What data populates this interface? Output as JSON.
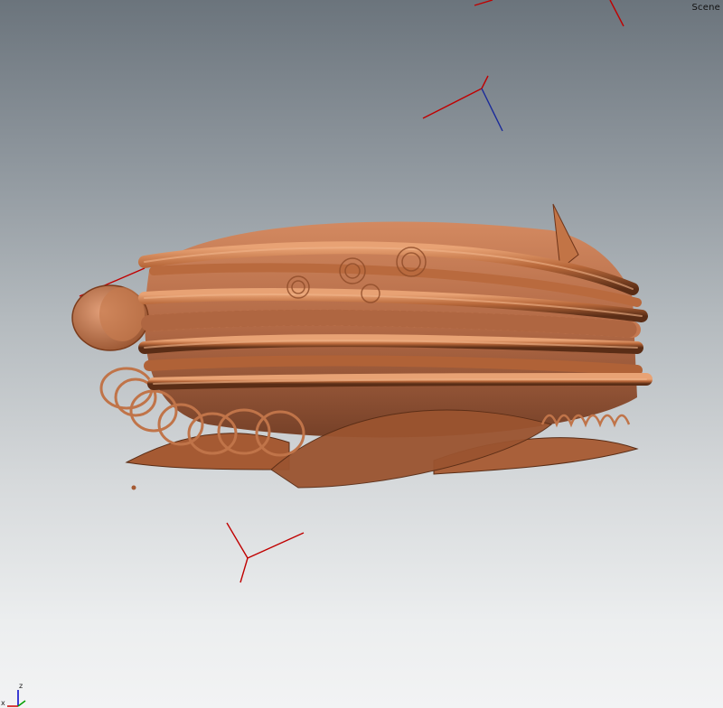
{
  "viewport": {
    "scene_label": "Scene",
    "background_top": "#6b747c",
    "background_bottom": "#f2f3f4"
  },
  "object": {
    "icon": "volume-render-copper-coils",
    "color": "#b8683a",
    "highlight": "#e49a6a",
    "shadow": "#5a2d16"
  },
  "axis_triad": {
    "x_label": "x",
    "z_label": "z",
    "x_color": "#d00000",
    "y_color": "#00a000",
    "z_color": "#0000c8"
  },
  "markers": {
    "line_color": "#c00000",
    "blue_color": "#1a2a9a"
  }
}
